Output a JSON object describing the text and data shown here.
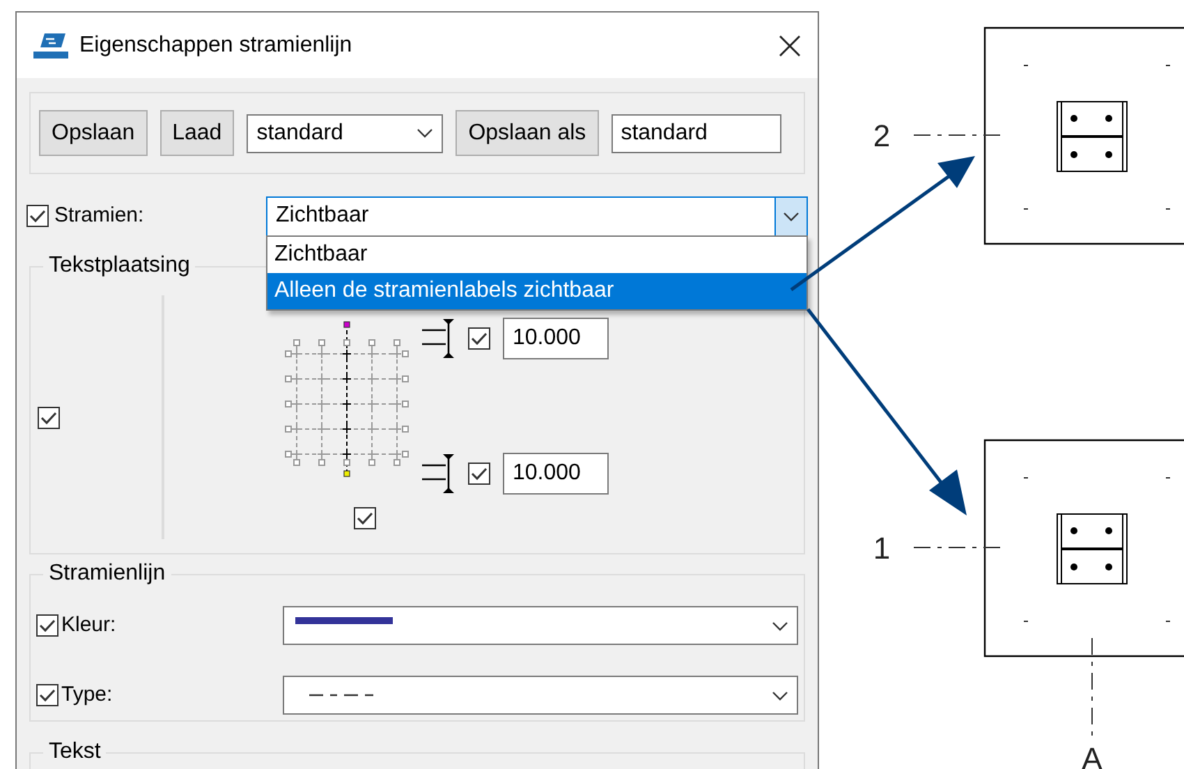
{
  "window": {
    "title": "Eigenschappen stramienlijn"
  },
  "toolbar": [
    {
      "kind": "button",
      "label": "Opslaan"
    },
    {
      "kind": "button",
      "label": "Laad"
    },
    {
      "kind": "select",
      "value": "standard"
    },
    {
      "kind": "button",
      "label": "Opslaan als"
    },
    {
      "kind": "input",
      "value": "standard"
    }
  ],
  "grid_setting": {
    "label": "Stramien:",
    "checked": true,
    "value": "Zichtbaar",
    "expanded": true,
    "options": [
      {
        "label": "Zichtbaar",
        "highlighted": false
      },
      {
        "label": "Alleen de stramienlabels zichtbaar",
        "highlighted": true
      }
    ]
  },
  "text_placement": {
    "title": "Tekstplaatsing",
    "left_checked": true,
    "offsets": [
      {
        "checked": true,
        "value": "10.000"
      },
      {
        "checked": true,
        "value": "10.000"
      }
    ],
    "bottom_checked": true
  },
  "grid_line": {
    "title": "Stramienlijn",
    "rows": [
      {
        "kind": "color",
        "label": "Kleur:",
        "checked": true,
        "color": "#333399"
      },
      {
        "kind": "linetype",
        "label": "Type:",
        "checked": true
      }
    ]
  },
  "text_section": {
    "title": "Tekst"
  },
  "drawing": {
    "views": [
      {
        "grid_label": "2"
      },
      {
        "grid_label": "1"
      }
    ],
    "bottom_label": "A"
  }
}
